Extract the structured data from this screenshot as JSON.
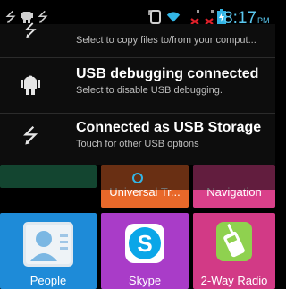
{
  "status_bar": {
    "time": "8:17",
    "ampm": "PM",
    "left_icons": [
      "usb-icon",
      "android-debug-icon",
      "usb-icon"
    ],
    "right_icons": [
      "screen-rotate-icon",
      "wifi-icon",
      "signal-off-icon",
      "signal-off-icon",
      "battery-icon"
    ]
  },
  "notifications": [
    {
      "icon": "usb-icon",
      "title": "",
      "subtitle": "Select to copy files to/from your comput..."
    },
    {
      "icon": "android-debug-icon",
      "title": "USB debugging connected",
      "subtitle": "Select to disable USB debugging."
    },
    {
      "icon": "usb-icon",
      "title": "Connected as USB Storage",
      "subtitle": "Touch for other USB options"
    }
  ],
  "home_tiles": [
    {
      "label": "Universal Tr...",
      "color": "#e8682a"
    },
    {
      "label": "Navigation",
      "color": "#d9408a"
    },
    {
      "label": "People",
      "color": "#1e8bd8"
    },
    {
      "label": "Skype",
      "color": "#a93cc8"
    },
    {
      "label": "2-Way Radio",
      "color": "#d23a86"
    }
  ],
  "colors": {
    "accent": "#33b5e5",
    "time": "#5ac8f0",
    "notification_bg": "#0d0d0d"
  }
}
